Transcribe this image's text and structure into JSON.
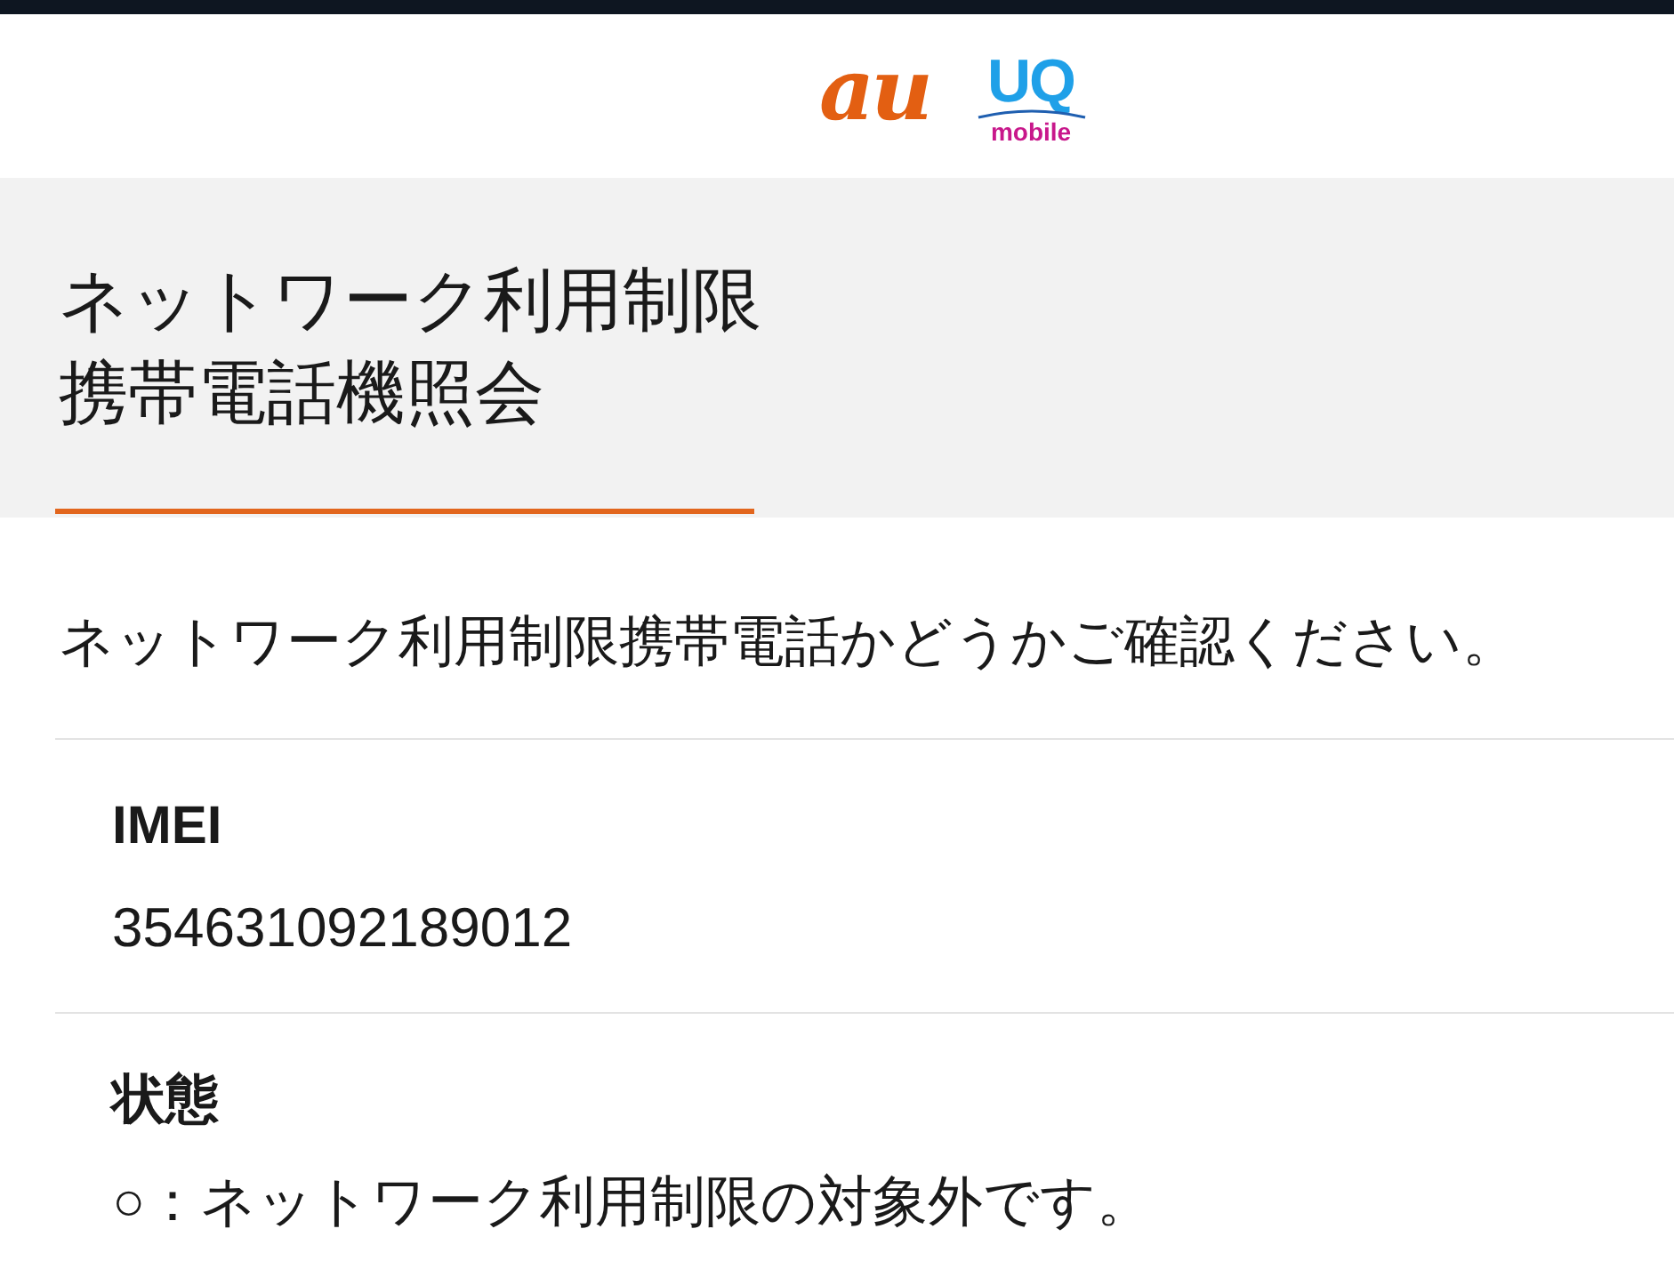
{
  "brand": {
    "logos": [
      {
        "kind": "au",
        "text": "au"
      },
      {
        "kind": "uq",
        "text": "UQ",
        "subtext": "mobile"
      }
    ]
  },
  "header": {
    "title_lines": [
      "ネットワーク利用制限",
      "携帯電話機照会"
    ]
  },
  "intro": "ネットワーク利用制限携帯電話かどうかご確認ください。",
  "fields": [
    {
      "label": "IMEI",
      "value": "354631092189012"
    },
    {
      "label": "状態",
      "value": "○：ネットワーク利用制限の対象外です。"
    }
  ]
}
